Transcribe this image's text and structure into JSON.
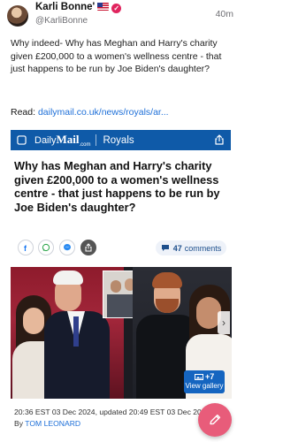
{
  "author": {
    "name": "Karli Bonne'",
    "handle": "@KarliBonne",
    "time": "40m"
  },
  "post": {
    "text": "Why indeed- Why has Meghan and Harry's charity given £200,000 to a women's wellness centre - that just happens to be run by Joe Biden's daughter?",
    "read_prefix": "Read: ",
    "link_text": "dailymail.co.uk/news/royals/ar..."
  },
  "card": {
    "brand_daily": "Daily",
    "brand_mail": "Mail",
    "brand_com": ".com",
    "section": "Royals",
    "headline": "Why has Meghan and Harry's charity given £200,000 to a women's wellness centre - that just happens to be run by Joe Biden's daughter?",
    "comments_count": "47",
    "comments_label": "comments",
    "gallery_count": "+7",
    "gallery_label": "View gallery",
    "dateline": "20:36 EST 03 Dec 2024, updated 20:49 EST 03 Dec 2024",
    "by_prefix": "By ",
    "author": "TOM LEONARD"
  },
  "colors": {
    "brand_blue": "#0f5aa8",
    "link": "#1d6fd8",
    "fab": "#e85c7a",
    "verified": "#e0245e"
  },
  "icons": [
    "flag-usa-icon",
    "verified-icon",
    "share-icon",
    "facebook-icon",
    "whatsapp-icon",
    "messenger-icon",
    "share-alt-icon",
    "comment-icon",
    "gallery-icon",
    "chevron-right-icon",
    "compose-icon"
  ]
}
